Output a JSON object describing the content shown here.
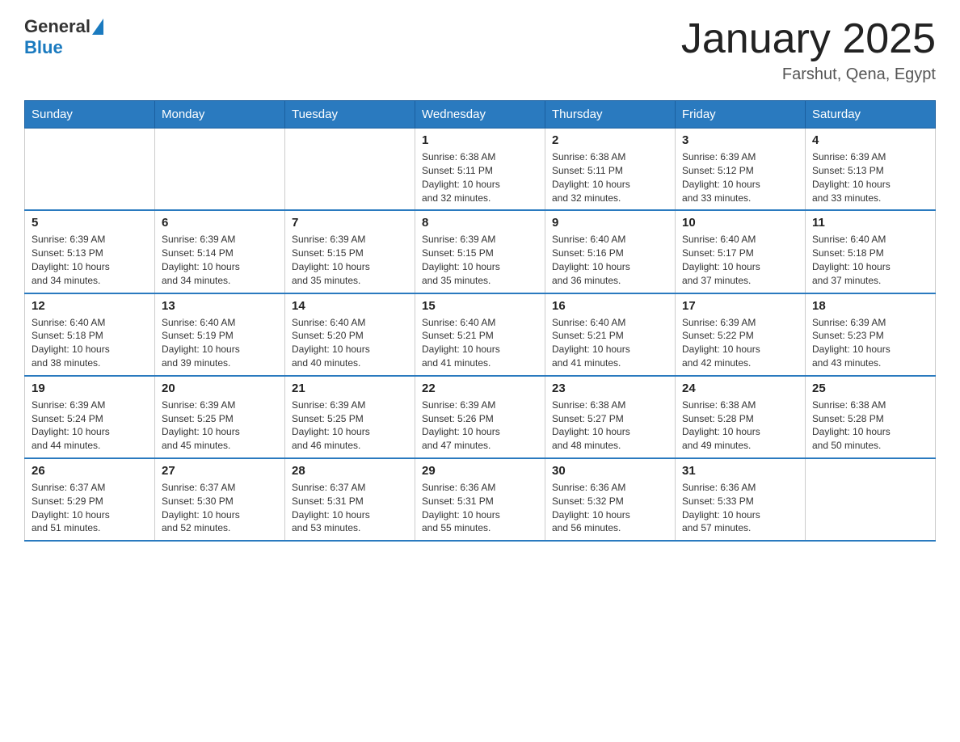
{
  "header": {
    "logo_general": "General",
    "logo_blue": "Blue",
    "month_title": "January 2025",
    "location": "Farshut, Qena, Egypt"
  },
  "weekdays": [
    "Sunday",
    "Monday",
    "Tuesday",
    "Wednesday",
    "Thursday",
    "Friday",
    "Saturday"
  ],
  "weeks": [
    [
      {
        "day": "",
        "info": ""
      },
      {
        "day": "",
        "info": ""
      },
      {
        "day": "",
        "info": ""
      },
      {
        "day": "1",
        "info": "Sunrise: 6:38 AM\nSunset: 5:11 PM\nDaylight: 10 hours\nand 32 minutes."
      },
      {
        "day": "2",
        "info": "Sunrise: 6:38 AM\nSunset: 5:11 PM\nDaylight: 10 hours\nand 32 minutes."
      },
      {
        "day": "3",
        "info": "Sunrise: 6:39 AM\nSunset: 5:12 PM\nDaylight: 10 hours\nand 33 minutes."
      },
      {
        "day": "4",
        "info": "Sunrise: 6:39 AM\nSunset: 5:13 PM\nDaylight: 10 hours\nand 33 minutes."
      }
    ],
    [
      {
        "day": "5",
        "info": "Sunrise: 6:39 AM\nSunset: 5:13 PM\nDaylight: 10 hours\nand 34 minutes."
      },
      {
        "day": "6",
        "info": "Sunrise: 6:39 AM\nSunset: 5:14 PM\nDaylight: 10 hours\nand 34 minutes."
      },
      {
        "day": "7",
        "info": "Sunrise: 6:39 AM\nSunset: 5:15 PM\nDaylight: 10 hours\nand 35 minutes."
      },
      {
        "day": "8",
        "info": "Sunrise: 6:39 AM\nSunset: 5:15 PM\nDaylight: 10 hours\nand 35 minutes."
      },
      {
        "day": "9",
        "info": "Sunrise: 6:40 AM\nSunset: 5:16 PM\nDaylight: 10 hours\nand 36 minutes."
      },
      {
        "day": "10",
        "info": "Sunrise: 6:40 AM\nSunset: 5:17 PM\nDaylight: 10 hours\nand 37 minutes."
      },
      {
        "day": "11",
        "info": "Sunrise: 6:40 AM\nSunset: 5:18 PM\nDaylight: 10 hours\nand 37 minutes."
      }
    ],
    [
      {
        "day": "12",
        "info": "Sunrise: 6:40 AM\nSunset: 5:18 PM\nDaylight: 10 hours\nand 38 minutes."
      },
      {
        "day": "13",
        "info": "Sunrise: 6:40 AM\nSunset: 5:19 PM\nDaylight: 10 hours\nand 39 minutes."
      },
      {
        "day": "14",
        "info": "Sunrise: 6:40 AM\nSunset: 5:20 PM\nDaylight: 10 hours\nand 40 minutes."
      },
      {
        "day": "15",
        "info": "Sunrise: 6:40 AM\nSunset: 5:21 PM\nDaylight: 10 hours\nand 41 minutes."
      },
      {
        "day": "16",
        "info": "Sunrise: 6:40 AM\nSunset: 5:21 PM\nDaylight: 10 hours\nand 41 minutes."
      },
      {
        "day": "17",
        "info": "Sunrise: 6:39 AM\nSunset: 5:22 PM\nDaylight: 10 hours\nand 42 minutes."
      },
      {
        "day": "18",
        "info": "Sunrise: 6:39 AM\nSunset: 5:23 PM\nDaylight: 10 hours\nand 43 minutes."
      }
    ],
    [
      {
        "day": "19",
        "info": "Sunrise: 6:39 AM\nSunset: 5:24 PM\nDaylight: 10 hours\nand 44 minutes."
      },
      {
        "day": "20",
        "info": "Sunrise: 6:39 AM\nSunset: 5:25 PM\nDaylight: 10 hours\nand 45 minutes."
      },
      {
        "day": "21",
        "info": "Sunrise: 6:39 AM\nSunset: 5:25 PM\nDaylight: 10 hours\nand 46 minutes."
      },
      {
        "day": "22",
        "info": "Sunrise: 6:39 AM\nSunset: 5:26 PM\nDaylight: 10 hours\nand 47 minutes."
      },
      {
        "day": "23",
        "info": "Sunrise: 6:38 AM\nSunset: 5:27 PM\nDaylight: 10 hours\nand 48 minutes."
      },
      {
        "day": "24",
        "info": "Sunrise: 6:38 AM\nSunset: 5:28 PM\nDaylight: 10 hours\nand 49 minutes."
      },
      {
        "day": "25",
        "info": "Sunrise: 6:38 AM\nSunset: 5:28 PM\nDaylight: 10 hours\nand 50 minutes."
      }
    ],
    [
      {
        "day": "26",
        "info": "Sunrise: 6:37 AM\nSunset: 5:29 PM\nDaylight: 10 hours\nand 51 minutes."
      },
      {
        "day": "27",
        "info": "Sunrise: 6:37 AM\nSunset: 5:30 PM\nDaylight: 10 hours\nand 52 minutes."
      },
      {
        "day": "28",
        "info": "Sunrise: 6:37 AM\nSunset: 5:31 PM\nDaylight: 10 hours\nand 53 minutes."
      },
      {
        "day": "29",
        "info": "Sunrise: 6:36 AM\nSunset: 5:31 PM\nDaylight: 10 hours\nand 55 minutes."
      },
      {
        "day": "30",
        "info": "Sunrise: 6:36 AM\nSunset: 5:32 PM\nDaylight: 10 hours\nand 56 minutes."
      },
      {
        "day": "31",
        "info": "Sunrise: 6:36 AM\nSunset: 5:33 PM\nDaylight: 10 hours\nand 57 minutes."
      },
      {
        "day": "",
        "info": ""
      }
    ]
  ]
}
